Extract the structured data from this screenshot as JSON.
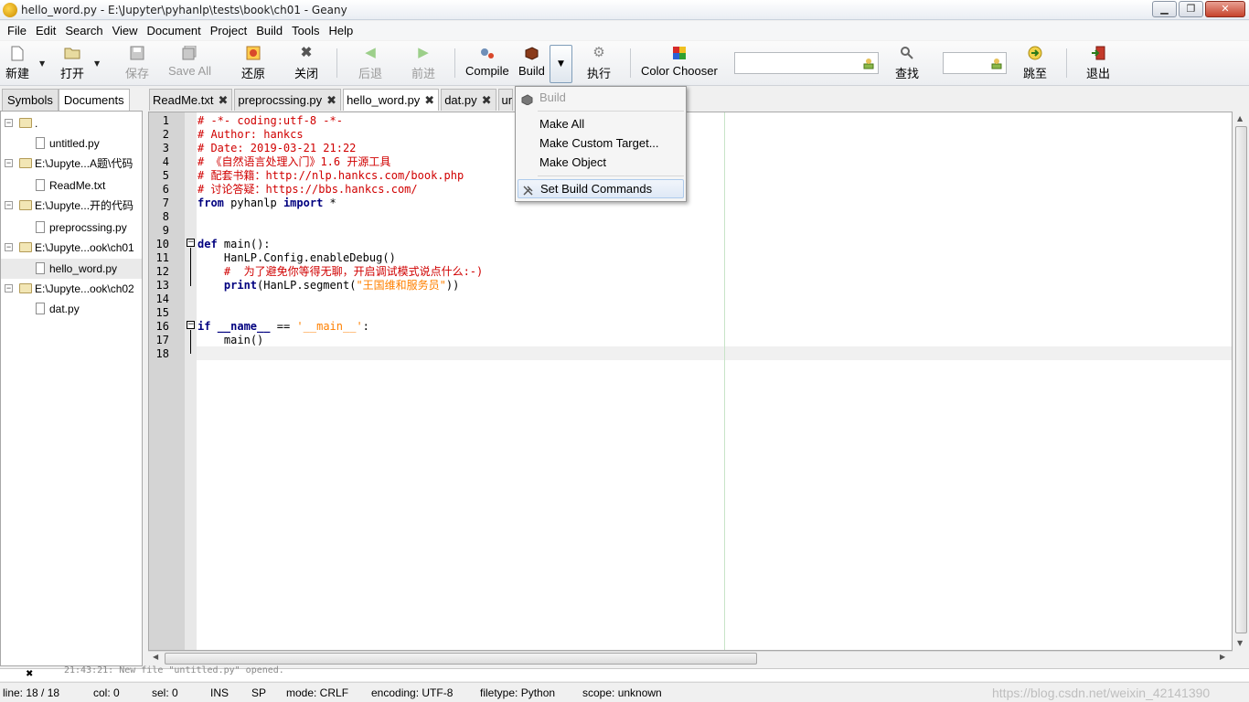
{
  "window": {
    "title": "hello_word.py - E:\\Jupyter\\pyhanlp\\tests\\book\\ch01 - Geany"
  },
  "menubar": [
    "File",
    "Edit",
    "Search",
    "View",
    "Document",
    "Project",
    "Build",
    "Tools",
    "Help"
  ],
  "toolbar": {
    "new": "新建",
    "open": "打开",
    "save": "保存",
    "save_all": "Save All",
    "revert": "还原",
    "close": "关闭",
    "back": "后退",
    "forward": "前进",
    "compile": "Compile",
    "build": "Build",
    "execute": "执行",
    "color_chooser": "Color Chooser",
    "find": "查找",
    "goto": "跳至",
    "quit": "退出"
  },
  "sidebar": {
    "tabs": [
      "Symbols",
      "Documents"
    ],
    "tree": [
      {
        "label": ".",
        "type": "folder"
      },
      {
        "label": "untitled.py",
        "type": "file"
      },
      {
        "label": "E:\\Jupyte...A题\\代码",
        "type": "folder"
      },
      {
        "label": "ReadMe.txt",
        "type": "file"
      },
      {
        "label": "E:\\Jupyte...开的代码",
        "type": "folder"
      },
      {
        "label": "preprocssing.py",
        "type": "file"
      },
      {
        "label": "E:\\Jupyte...ook\\ch01",
        "type": "folder"
      },
      {
        "label": "hello_word.py",
        "type": "file",
        "selected": true
      },
      {
        "label": "E:\\Jupyte...ook\\ch02",
        "type": "folder"
      },
      {
        "label": "dat.py",
        "type": "file"
      }
    ]
  },
  "editor_tabs": [
    "ReadMe.txt",
    "preprocssing.py",
    "hello_word.py",
    "dat.py",
    "ur"
  ],
  "code_lines": [
    "# -*- coding:utf-8 -*-",
    "# Author: hankcs",
    "# Date: 2019-03-21 21:22",
    "# 《自然语言处理入门》1.6 开源工具",
    "# 配套书籍：http://nlp.hankcs.com/book.php",
    "# 讨论答疑：https://bbs.hankcs.com/",
    "from pyhanlp import *",
    "",
    "",
    "def main():",
    "    HanLP.Config.enableDebug()",
    "    #  为了避免你等得无聊，开启调试模式说点什么:-)",
    "    print(HanLP.segment(\"王国维和服务员\"))",
    "",
    "",
    "if __name__ == '__main__':",
    "    main()",
    ""
  ],
  "build_menu": {
    "header": "Build",
    "items": [
      "Make All",
      "Make Custom Target...",
      "Make Object"
    ],
    "settings": "Set Build Commands"
  },
  "message_strip": "21:43:21: New file \"untitled.py\" opened.",
  "status": {
    "line": "line: 18 / 18",
    "col": "col: 0",
    "sel": "sel: 0",
    "ins": "INS",
    "sp": "SP",
    "mode": "mode: CRLF",
    "encoding": "encoding: UTF-8",
    "filetype": "filetype: Python",
    "scope": "scope: unknown"
  },
  "watermark": "https://blog.csdn.net/weixin_42141390",
  "colors": {
    "comment": "#d00000",
    "keyword": "#00007f",
    "string": "#ff8000",
    "gutter": "#d4d4d4"
  }
}
